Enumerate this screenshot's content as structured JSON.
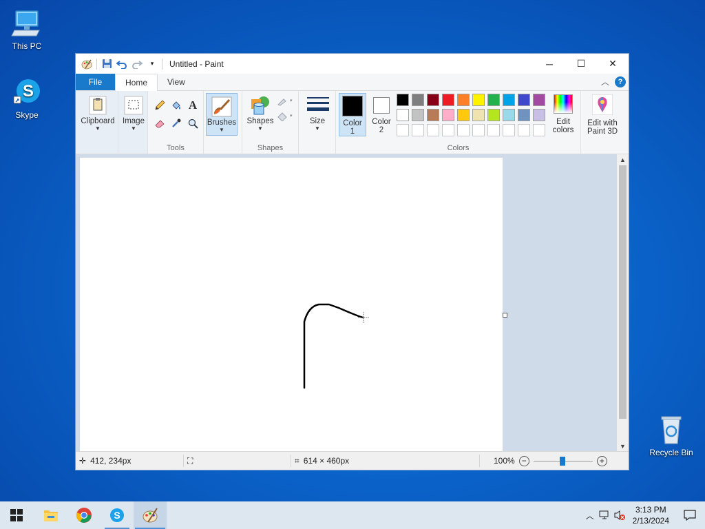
{
  "desktop": {
    "icons": [
      {
        "label": "This PC"
      },
      {
        "label": "Skype"
      },
      {
        "label": "Recycle Bin"
      }
    ]
  },
  "window": {
    "title": "Untitled - Paint",
    "controls": {
      "minimize": "─",
      "maximize": "☐",
      "close": "✕"
    }
  },
  "tabs": {
    "file": "File",
    "home": "Home",
    "view": "View"
  },
  "ribbon": {
    "clipboard": "Clipboard",
    "image": "Image",
    "tools": "Tools",
    "brushes": "Brushes",
    "shapes_button": "Shapes",
    "shapes_group": "Shapes",
    "size": "Size",
    "color1_line1": "Color",
    "color1_line2": "1",
    "color2_line1": "Color",
    "color2_line2": "2",
    "colors_group": "Colors",
    "edit_colors_line1": "Edit",
    "edit_colors_line2": "colors",
    "paint3d_line1": "Edit with",
    "paint3d_line2": "Paint 3D",
    "palette_row1": [
      "#000000",
      "#7f7f7f",
      "#880015",
      "#ed1c24",
      "#ff7f27",
      "#fff200",
      "#22b14c",
      "#00a2e8",
      "#3f48cc",
      "#a349a4"
    ],
    "palette_row2": [
      "#ffffff",
      "#c3c3c3",
      "#b97a57",
      "#ffaec9",
      "#ffc90e",
      "#efe4b0",
      "#b5e61d",
      "#99d9ea",
      "#7092be",
      "#c8bfe7"
    ],
    "color1_value": "#000000",
    "color2_value": "#ffffff"
  },
  "status": {
    "cursor_pos": "412, 234px",
    "canvas_size": "614 × 460px",
    "zoom": "100%"
  },
  "taskbar": {
    "time": "3:13 PM",
    "date": "2/13/2024"
  },
  "colors": {
    "accent": "#1979ca",
    "canvas_bg": "#cfdbe9"
  }
}
